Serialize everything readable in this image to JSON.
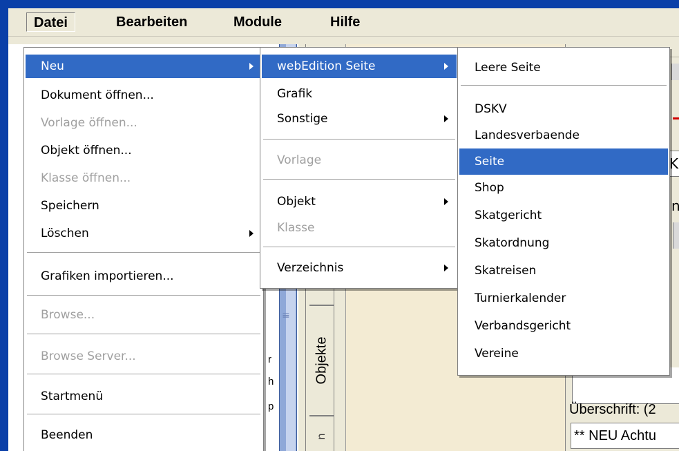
{
  "menubar": {
    "items": [
      "Datei",
      "Bearbeiten",
      "Module",
      "Hilfe"
    ]
  },
  "datei_menu": {
    "items": [
      {
        "label": "Neu",
        "highlight": true,
        "submenu": true
      },
      {
        "label": "Dokument öffnen..."
      },
      {
        "label": "Vorlage öffnen...",
        "disabled": true
      },
      {
        "label": "Objekt öffnen..."
      },
      {
        "label": "Klasse öffnen...",
        "disabled": true
      },
      {
        "label": "Speichern"
      },
      {
        "label": "Löschen",
        "submenu": true
      },
      {
        "label": "Grafiken importieren..."
      },
      {
        "label": "Browse...",
        "disabled": true
      },
      {
        "label": "Browse Server...",
        "disabled": true
      },
      {
        "label": "Startmenü"
      },
      {
        "label": "Beenden"
      }
    ]
  },
  "neu_menu": {
    "items": [
      {
        "label": "webEdition Seite",
        "highlight": true,
        "submenu": true
      },
      {
        "label": "Grafik"
      },
      {
        "label": "Sonstige",
        "submenu": true
      },
      {
        "label": "Vorlage",
        "disabled": true
      },
      {
        "label": "Objekt",
        "submenu": true
      },
      {
        "label": "Klasse",
        "disabled": true
      },
      {
        "label": "Verzeichnis",
        "submenu": true
      }
    ]
  },
  "webedition_menu": {
    "items": [
      {
        "label": "Leere Seite"
      },
      {
        "label": "DSKV"
      },
      {
        "label": "Landesverbaende"
      },
      {
        "label": "Seite",
        "highlight": true
      },
      {
        "label": "Shop"
      },
      {
        "label": "Skatgericht"
      },
      {
        "label": "Skatordnung"
      },
      {
        "label": "Skatreisen"
      },
      {
        "label": "Turnierkalender"
      },
      {
        "label": "Verbandsgericht"
      },
      {
        "label": "Vereine"
      }
    ]
  },
  "background": {
    "tab_objekte": "Objekte",
    "heading_label": "Überschrift: (2",
    "field_value": "** NEU Achtu",
    "right_field": "K",
    "right_text": "n",
    "left_letters": [
      "r",
      "h",
      "p"
    ]
  },
  "colors": {
    "highlight": "#316ac5",
    "window_bg": "#ece9d8",
    "desktop": "#0a3fa8"
  }
}
